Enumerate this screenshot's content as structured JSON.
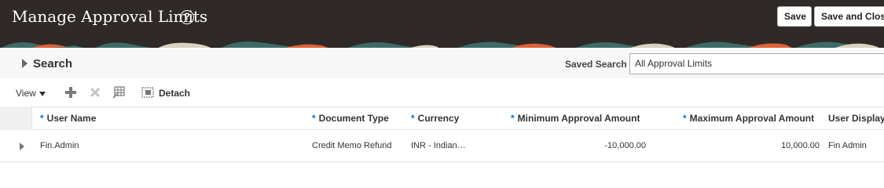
{
  "header": {
    "title": "Manage Approval Limits",
    "help_icon": "help-circle-icon",
    "help_glyph": "?",
    "buttons": {
      "save": "Save",
      "save_and_close": "Save and Close"
    }
  },
  "search": {
    "title": "Search",
    "saved_search_label": "Saved Search",
    "saved_search_value": "All Approval Limits"
  },
  "toolbar": {
    "view_label": "View",
    "icons": [
      "add-icon",
      "delete-icon",
      "freeze-icon",
      "detach-icon"
    ],
    "detach_label": "Detach"
  },
  "table": {
    "required_marker": "*",
    "columns": {
      "user_name": "User Name",
      "document_type": "Document Type",
      "currency": "Currency",
      "min_amount": "Minimum Approval Amount",
      "max_amount": "Maximum Approval Amount",
      "user_display": "User Display"
    },
    "rows": [
      {
        "user_name": "Fin.Admin",
        "document_type": "Credit Memo Refund",
        "currency": "INR - Indian…",
        "min_amount": "-10,000.00",
        "max_amount": "10,000.00",
        "user_display": "Fin Admin"
      }
    ]
  },
  "colors": {
    "header_bg": "#2f2a27",
    "required_star": "#0572ce",
    "banner_orange": "#e0623a",
    "banner_teal": "#3e6b67"
  }
}
